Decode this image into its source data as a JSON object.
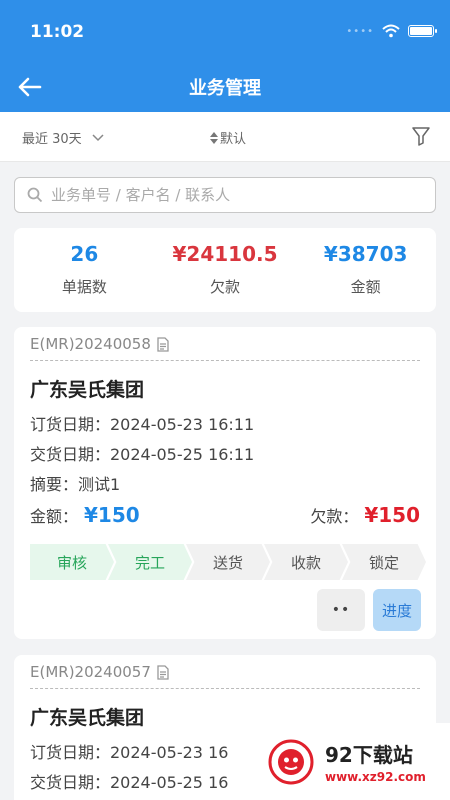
{
  "status": {
    "time": "11:02"
  },
  "header": {
    "title": "业务管理"
  },
  "filters": {
    "range": "最近 30天",
    "sort": "默认"
  },
  "search": {
    "placeholder": "业务单号 / 客户名 / 联系人"
  },
  "stats": [
    {
      "value": "26",
      "label": "单据数",
      "color": "#1e88e5"
    },
    {
      "value": "¥24110.5",
      "label": "欠款",
      "color": "#d9363e"
    },
    {
      "value": "¥38703",
      "label": "金额",
      "color": "#1e88e5"
    }
  ],
  "orders": [
    {
      "no": "E(MR)20240058",
      "customer": "广东吴氏集团",
      "order_date": "订货日期：2024-05-23 16:11",
      "delivery_date": "交货日期：2024-05-25 16:11",
      "summary": "摘要：测试1",
      "amount_label": "金额：",
      "amount": "¥150",
      "debt_label": "欠款：",
      "debt": "¥150",
      "steps": [
        {
          "label": "审核",
          "done": true
        },
        {
          "label": "完工",
          "done": true
        },
        {
          "label": "送货",
          "done": false
        },
        {
          "label": "收款",
          "done": false
        },
        {
          "label": "锁定",
          "done": false
        }
      ],
      "more_label": "••",
      "progress_label": "进度"
    },
    {
      "no": "E(MR)20240057",
      "customer": "广东吴氏集团",
      "order_date": "订货日期：2024-05-23 16",
      "delivery_date": "交货日期：2024-05-25 16"
    }
  ],
  "watermark": {
    "title": "92下载站",
    "url": "www.xz92.com"
  }
}
